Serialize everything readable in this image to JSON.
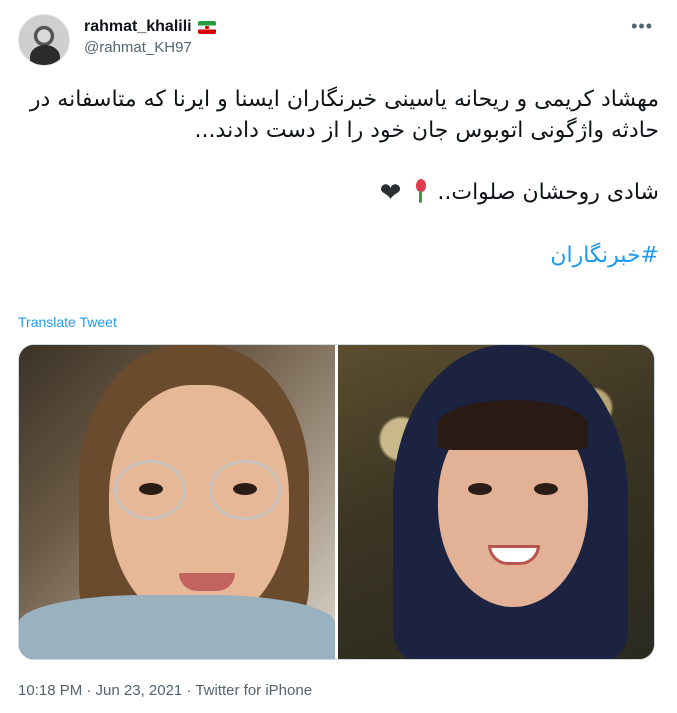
{
  "user": {
    "display_name": "rahmat_khalili",
    "handle": "@rahmat_KH97",
    "flag_icon": "iran-flag-icon",
    "more_icon": "more-horizontal-icon"
  },
  "tweet": {
    "paragraph1": "مهشاد کریمی و ریحانه یاسینی خبرنگاران ایسنا و ایرنا که متاسفانه در حادثه واژگونی اتوبوس جان خود را از دست دادند...",
    "paragraph2_text": "شادی روحشان صلوات..",
    "emoji1": "wilted-rose-emoji",
    "emoji2_char": "❤",
    "hashtag": "#خبرنگاران"
  },
  "translate_label": "Translate Tweet",
  "media": {
    "photo_count": 2
  },
  "meta": {
    "timestamp": "10:18 PM · Jun 23, 2021 · Twitter for iPhone"
  },
  "colors": {
    "link": "#1d9bf0",
    "secondary_text": "#536471",
    "primary_text": "#0f1419"
  }
}
